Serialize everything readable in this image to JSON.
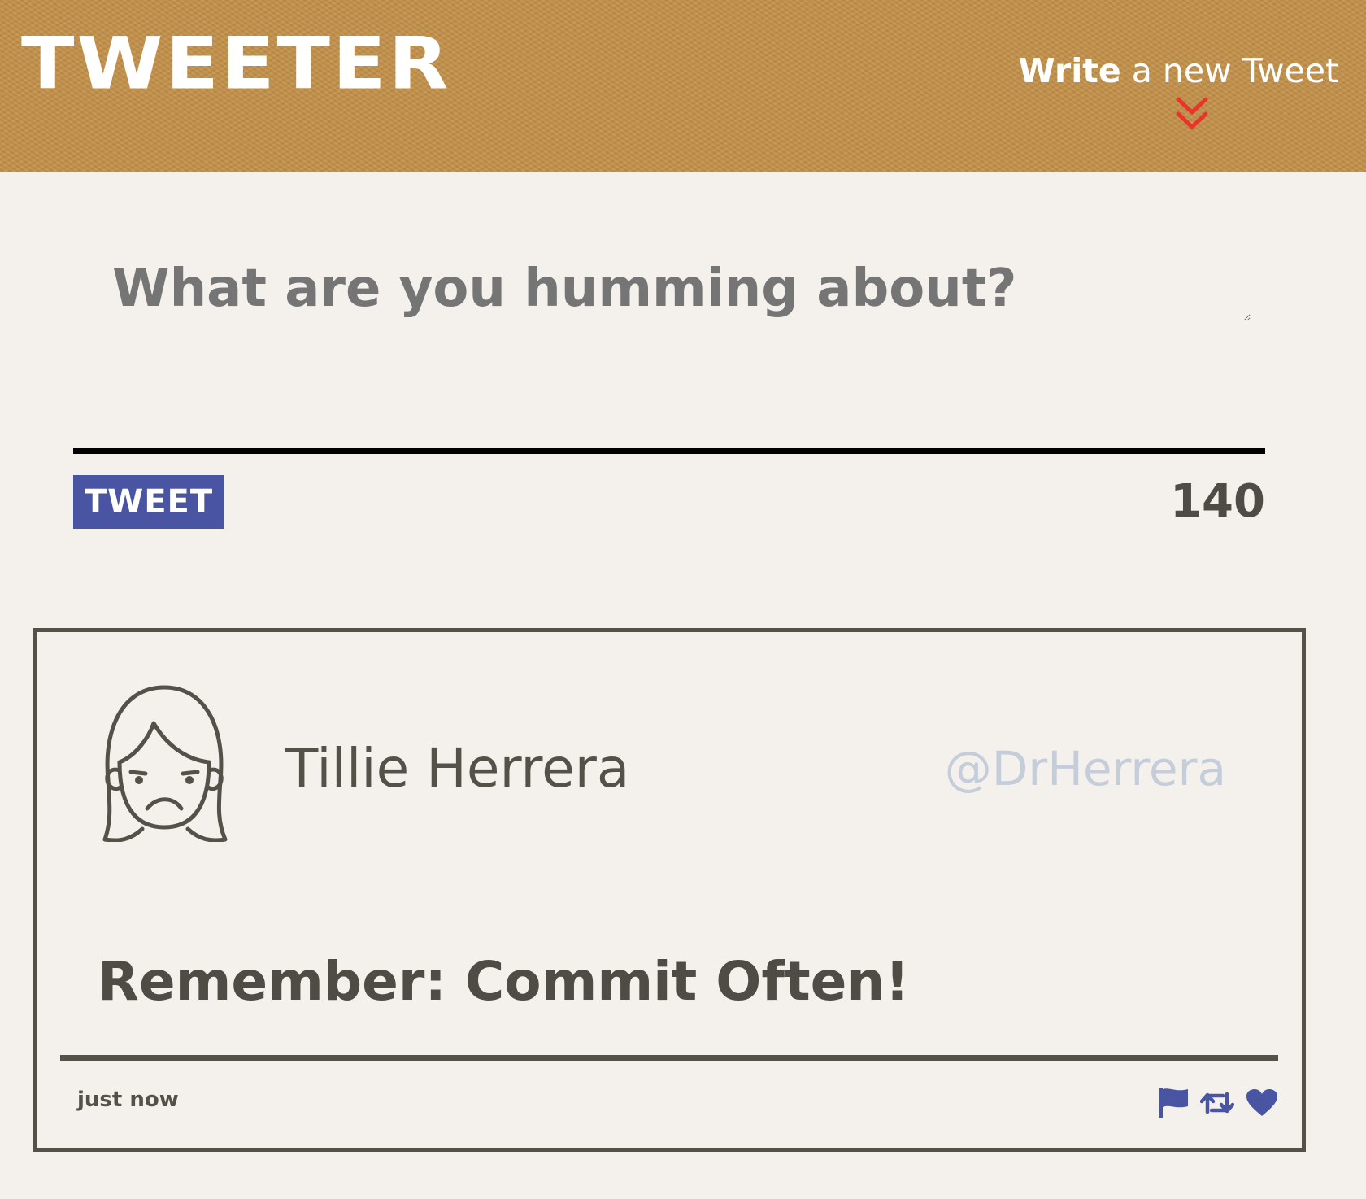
{
  "header": {
    "logo": "TWEETER",
    "compose_toggle": {
      "strong": "Write",
      "rest": " a new Tweet"
    }
  },
  "composer": {
    "placeholder": "What are you humming about?",
    "button_label": "TWEET",
    "counter": "140"
  },
  "tweet": {
    "author_name": "Tillie Herrera",
    "handle": "@DrHerrera",
    "content": "Remember: Commit Often!",
    "timestamp": "just now"
  },
  "icons": {
    "toggle": "double-chevron-down-icon",
    "avatar": "face-avatar-icon",
    "flag": "flag-icon",
    "retweet": "retweet-icon",
    "like": "heart-icon"
  },
  "colors": {
    "header_bg": "#c4924a",
    "page_bg": "#f4f1ec",
    "text": "#545149",
    "accent_blue": "#4955a3",
    "chevron_red": "#e8352b",
    "handle_gray": "#c5ccda"
  }
}
